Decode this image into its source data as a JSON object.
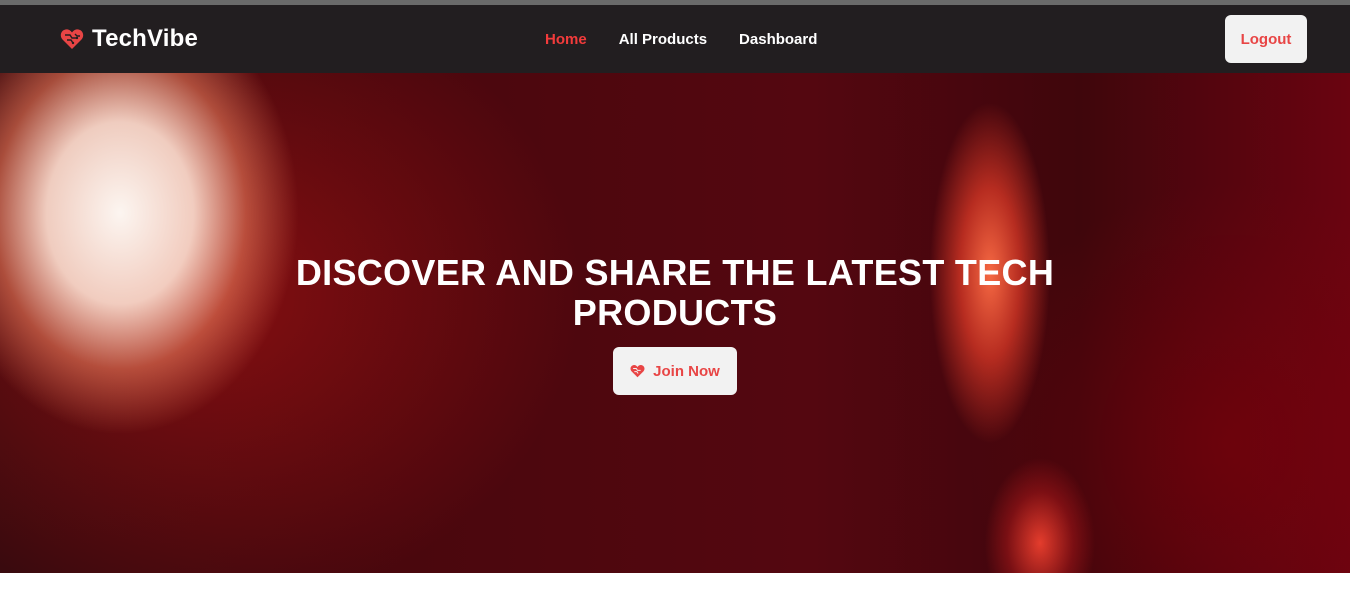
{
  "brand": {
    "name": "TechVibe",
    "icon": "heart-circuit-icon",
    "accent_color": "#e84545"
  },
  "nav": {
    "links": [
      {
        "label": "Home",
        "active": true
      },
      {
        "label": "All Products",
        "active": false
      },
      {
        "label": "Dashboard",
        "active": false
      }
    ],
    "active_color": "#f23b3b",
    "logout_label": "Logout"
  },
  "hero": {
    "title": "DISCOVER AND SHARE THE LATEST TECH PRODUCTS",
    "cta_label": "Join Now",
    "cta_icon": "heart-circuit-icon",
    "background_color": "#540710"
  }
}
